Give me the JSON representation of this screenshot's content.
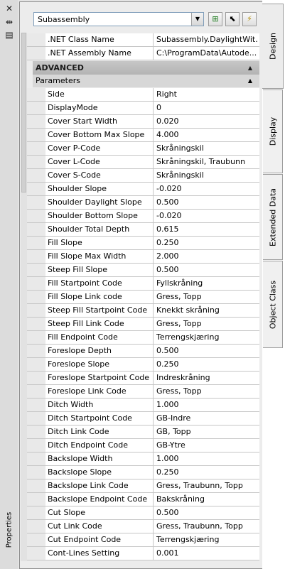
{
  "palette": {
    "close_icon": "close-icon",
    "vertical_label": "Properties"
  },
  "toolbar": {
    "object_type": "Subassembly"
  },
  "header_rows": [
    {
      "name": ".NET Class Name",
      "value": "Subassembly.DaylightWit..."
    },
    {
      "name": ".NET Assembly Name",
      "value": "C:\\ProgramData\\Autode..."
    }
  ],
  "category": "ADVANCED",
  "subcategory": "Parameters",
  "params": [
    {
      "name": "Side",
      "value": "Right"
    },
    {
      "name": "DisplayMode",
      "value": "0"
    },
    {
      "name": "Cover Start Width",
      "value": "0.020"
    },
    {
      "name": "Cover Bottom Max Slope",
      "value": "4.000"
    },
    {
      "name": "Cover P-Code",
      "value": "Skråningskil"
    },
    {
      "name": "Cover L-Code",
      "value": "Skråningskil, Traubunn"
    },
    {
      "name": "Cover S-Code",
      "value": "Skråningskil"
    },
    {
      "name": "Shoulder Slope",
      "value": "-0.020"
    },
    {
      "name": "Shoulder Daylight Slope",
      "value": "0.500"
    },
    {
      "name": "Shoulder Bottom Slope",
      "value": "-0.020"
    },
    {
      "name": "Shoulder Total Depth",
      "value": "0.615"
    },
    {
      "name": "Fill Slope",
      "value": "0.250"
    },
    {
      "name": "Fill Slope Max Width",
      "value": "2.000"
    },
    {
      "name": "Steep Fill Slope",
      "value": "0.500"
    },
    {
      "name": "Fill Startpoint Code",
      "value": "Fyllskråning"
    },
    {
      "name": "Fill Slope Link code",
      "value": "Gress, Topp"
    },
    {
      "name": "Steep Fill Startpoint Code",
      "value": "Knekkt skråning"
    },
    {
      "name": "Steep Fill Link Code",
      "value": "Gress, Topp"
    },
    {
      "name": "Fill Endpoint Code",
      "value": "Terrengskjæring"
    },
    {
      "name": "Foreslope Depth",
      "value": "0.500"
    },
    {
      "name": "Foreslope Slope",
      "value": "0.250"
    },
    {
      "name": "Foreslope Startpoint Code",
      "value": "Indreskråning"
    },
    {
      "name": "Foreslope Link Code",
      "value": "Gress, Topp"
    },
    {
      "name": "Ditch Width",
      "value": "1.000"
    },
    {
      "name": "Ditch Startpoint Code",
      "value": "GB-Indre"
    },
    {
      "name": "Ditch Link Code",
      "value": "GB, Topp"
    },
    {
      "name": "Ditch Endpoint Code",
      "value": "GB-Ytre"
    },
    {
      "name": "Backslope Width",
      "value": "1.000"
    },
    {
      "name": "Backslope Slope",
      "value": "0.250"
    },
    {
      "name": "Backslope Link Code",
      "value": "Gress, Traubunn, Topp"
    },
    {
      "name": "Backslope Endpoint Code",
      "value": "Bakskråning"
    },
    {
      "name": "Cut Slope",
      "value": "0.500"
    },
    {
      "name": "Cut Link Code",
      "value": "Gress, Traubunn, Topp"
    },
    {
      "name": "Cut Endpoint Code",
      "value": "Terrengskjæring"
    },
    {
      "name": "Cont-Lines Setting",
      "value": "0.001"
    }
  ],
  "tabs": [
    {
      "label": "Design",
      "active": true
    },
    {
      "label": "Display",
      "active": false
    },
    {
      "label": "Extended Data",
      "active": false
    },
    {
      "label": "Object Class",
      "active": false
    }
  ]
}
